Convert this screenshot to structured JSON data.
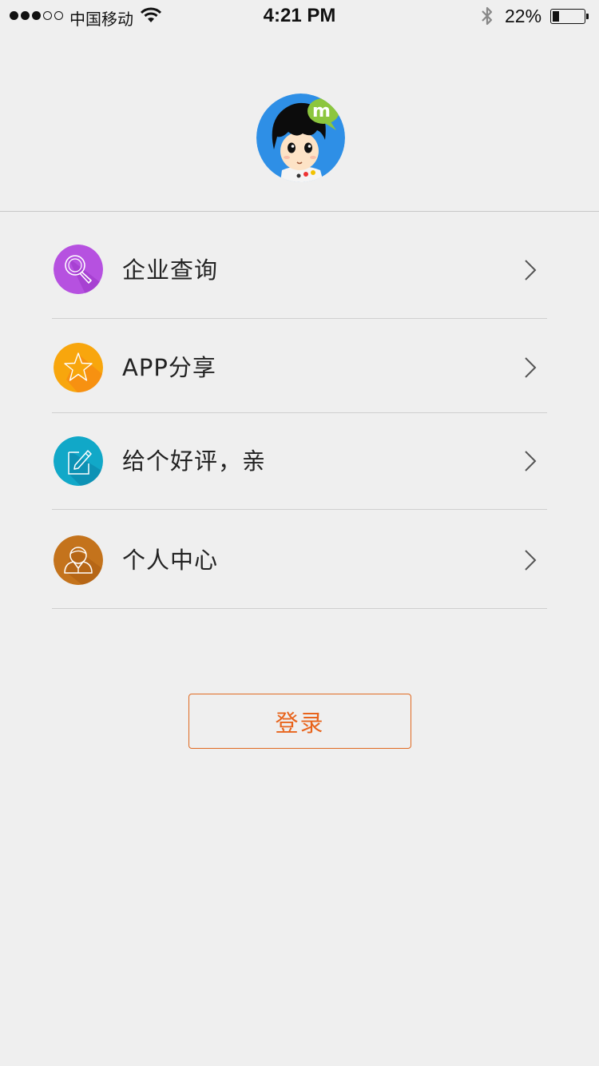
{
  "status_bar": {
    "signal_dots_filled": 3,
    "signal_dots_total": 5,
    "carrier": "中国移动",
    "time": "4:21 PM",
    "battery_percent": "22%",
    "battery_level": 0.22,
    "icons": [
      "wifi-icon",
      "bluetooth-icon",
      "battery-icon"
    ]
  },
  "profile": {
    "avatar_icon": "cartoon-avatar-icon",
    "badge_text": "m"
  },
  "menu": {
    "items": [
      {
        "label": "企业查询",
        "icon": "search-icon",
        "color": "#b651e0"
      },
      {
        "label": "APP分享",
        "icon": "star-icon",
        "color": "#f8a60d"
      },
      {
        "label": "给个好评，亲",
        "icon": "edit-icon",
        "color": "#11a8c8"
      },
      {
        "label": "个人中心",
        "icon": "user-icon",
        "color": "#c4731c"
      }
    ]
  },
  "login": {
    "label": "登录",
    "color": "#e8641c"
  }
}
